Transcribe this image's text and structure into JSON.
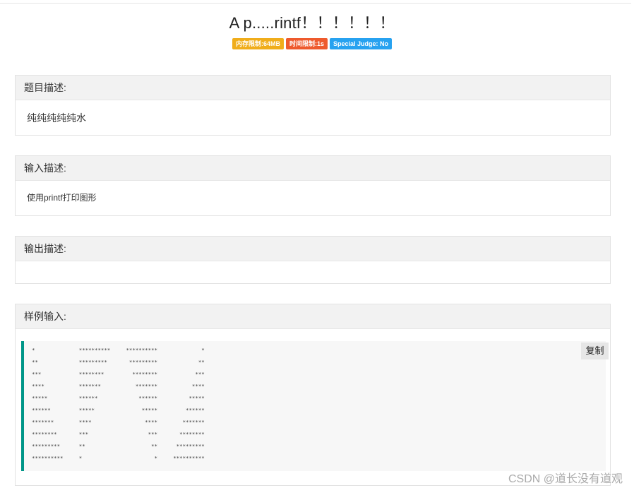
{
  "problem": {
    "title": "A p.....rintf！！！！！！",
    "badges": {
      "memory": "内存限制:64MB",
      "time": "时间限制:1s",
      "special_judge": "Special Judge: No"
    }
  },
  "sections": {
    "description": {
      "heading": "题目描述:",
      "body": "纯纯纯纯纯水"
    },
    "input": {
      "heading": "输入描述:",
      "body": "使用printf打印图形"
    },
    "output": {
      "heading": "输出描述:",
      "body": ""
    },
    "sample_input": {
      "heading": "样例输入:",
      "copy_label": "复制",
      "code": "*              **********     **********              *\n**             *********       *********             **\n***            ********         ********            ***\n****           *******           *******           ****\n*****          ******             ******          *****\n******         *****               *****         ******\n*******        ****                 ****        *******\n********       ***                   ***       ********\n*********      **                     **      *********\n**********     *                       *     **********"
    }
  },
  "watermark": "CSDN @道长没有道观",
  "colors": {
    "memory_badge": "#f0ad1b",
    "time_badge": "#ee5a2d",
    "judge_badge": "#27a2f0",
    "code_accent": "#009688"
  }
}
